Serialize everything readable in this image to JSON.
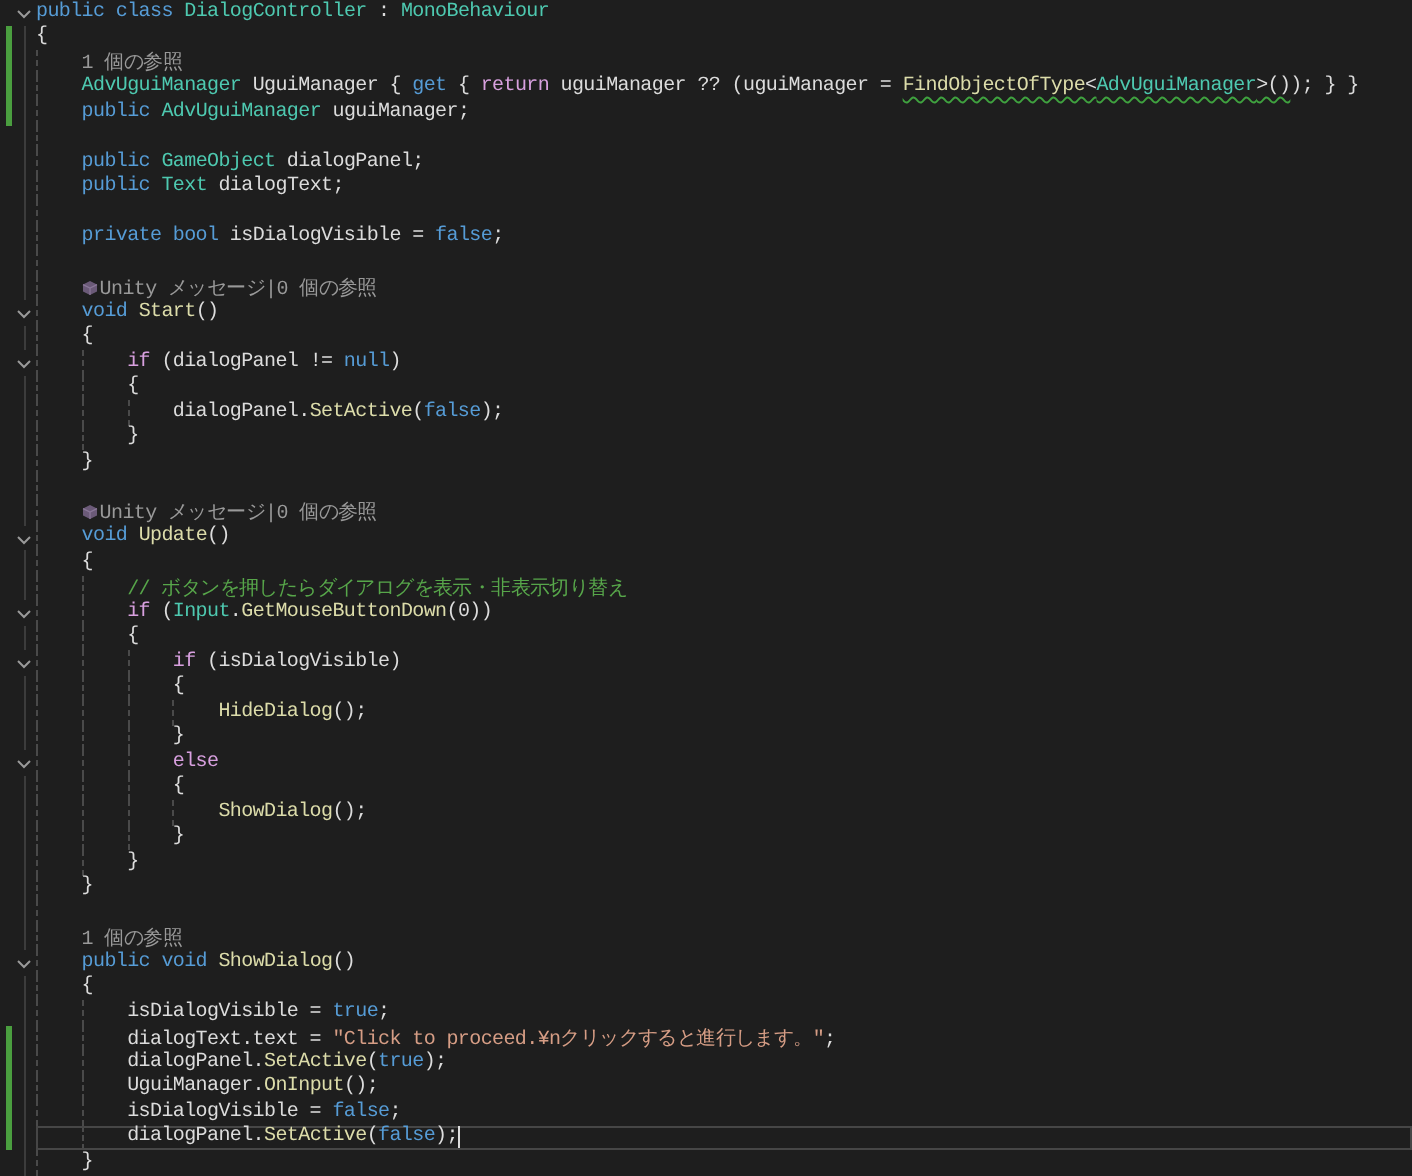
{
  "lines": [
    {
      "kind": "code",
      "fold": true,
      "changed": false,
      "current": false,
      "tokens": [
        {
          "kind": "kw",
          "text": "public class "
        },
        {
          "kind": "type",
          "text": "DialogController"
        },
        {
          "kind": "plain",
          "text": " : "
        },
        {
          "kind": "type",
          "text": "MonoBehaviour"
        }
      ]
    },
    {
      "kind": "code",
      "fold": false,
      "changed": true,
      "current": false,
      "tokens": [
        {
          "kind": "plain",
          "text": "{"
        }
      ],
      "children": [
        {
          "kind": "lens",
          "fold": false,
          "changed": true,
          "current": false,
          "text": "1 個の参照"
        },
        {
          "kind": "code",
          "fold": false,
          "changed": true,
          "current": false,
          "tokens": [
            {
              "kind": "type",
              "text": "AdvUguiManager"
            },
            {
              "kind": "plain",
              "text": " UguiManager { "
            },
            {
              "kind": "kw",
              "text": "get"
            },
            {
              "kind": "plain",
              "text": " { "
            },
            {
              "kind": "ctrl",
              "text": "return"
            },
            {
              "kind": "plain",
              "text": " uguiManager ?? (uguiManager = "
            },
            {
              "kind": "method_warn",
              "text": "FindObjectOfType"
            },
            {
              "kind": "plain_warn",
              "text": "<"
            },
            {
              "kind": "type_warn",
              "text": "AdvUguiManager"
            },
            {
              "kind": "plain_warn",
              "text": ">()"
            },
            {
              "kind": "plain",
              "text": "); } }"
            }
          ]
        },
        {
          "kind": "code",
          "fold": false,
          "changed": true,
          "current": false,
          "tokens": [
            {
              "kind": "kw",
              "text": "public "
            },
            {
              "kind": "type",
              "text": "AdvUguiManager"
            },
            {
              "kind": "plain",
              "text": " uguiManager;"
            }
          ]
        },
        {
          "kind": "blank",
          "fold": false,
          "changed": false,
          "current": false
        },
        {
          "kind": "code",
          "fold": false,
          "changed": false,
          "current": false,
          "tokens": [
            {
              "kind": "kw",
              "text": "public "
            },
            {
              "kind": "type",
              "text": "GameObject"
            },
            {
              "kind": "plain",
              "text": " dialogPanel;"
            }
          ]
        },
        {
          "kind": "code",
          "fold": false,
          "changed": false,
          "current": false,
          "tokens": [
            {
              "kind": "kw",
              "text": "public "
            },
            {
              "kind": "type",
              "text": "Text"
            },
            {
              "kind": "plain",
              "text": " dialogText;"
            }
          ]
        },
        {
          "kind": "blank",
          "fold": false,
          "changed": false,
          "current": false
        },
        {
          "kind": "code",
          "fold": false,
          "changed": false,
          "current": false,
          "tokens": [
            {
              "kind": "kw",
              "text": "private bool "
            },
            {
              "kind": "plain",
              "text": "isDialogVisible = "
            },
            {
              "kind": "kw",
              "text": "false"
            },
            {
              "kind": "plain",
              "text": ";"
            }
          ]
        },
        {
          "kind": "blank",
          "fold": false,
          "changed": false,
          "current": false
        },
        {
          "kind": "unity_lens",
          "fold": false,
          "changed": false,
          "current": false,
          "text": "Unity メッセージ|0 個の参照"
        },
        {
          "kind": "code",
          "fold": true,
          "changed": false,
          "current": false,
          "tokens": [
            {
              "kind": "kw",
              "text": "void "
            },
            {
              "kind": "method",
              "text": "Start"
            },
            {
              "kind": "plain",
              "text": "()"
            }
          ]
        },
        {
          "kind": "code",
          "fold": false,
          "changed": false,
          "current": false,
          "tokens": [
            {
              "kind": "plain",
              "text": "{"
            }
          ],
          "children": [
            {
              "kind": "code",
              "fold": true,
              "changed": false,
              "current": false,
              "tokens": [
                {
                  "kind": "ctrl",
                  "text": "if"
                },
                {
                  "kind": "plain",
                  "text": " (dialogPanel != "
                },
                {
                  "kind": "kw",
                  "text": "null"
                },
                {
                  "kind": "plain",
                  "text": ")"
                }
              ]
            },
            {
              "kind": "code",
              "fold": false,
              "changed": false,
              "current": false,
              "tokens": [
                {
                  "kind": "plain",
                  "text": "{"
                }
              ],
              "children": [
                {
                  "kind": "code",
                  "fold": false,
                  "changed": false,
                  "current": false,
                  "tokens": [
                    {
                      "kind": "plain",
                      "text": "dialogPanel."
                    },
                    {
                      "kind": "method",
                      "text": "SetActive"
                    },
                    {
                      "kind": "plain",
                      "text": "("
                    },
                    {
                      "kind": "kw",
                      "text": "false"
                    },
                    {
                      "kind": "plain",
                      "text": ");"
                    }
                  ]
                }
              ]
            },
            {
              "kind": "code",
              "fold": false,
              "changed": false,
              "current": false,
              "tokens": [
                {
                  "kind": "plain",
                  "text": "}"
                }
              ]
            }
          ]
        },
        {
          "kind": "code",
          "fold": false,
          "changed": false,
          "current": false,
          "tokens": [
            {
              "kind": "plain",
              "text": "}"
            }
          ]
        },
        {
          "kind": "blank",
          "fold": false,
          "changed": false,
          "current": false
        },
        {
          "kind": "unity_lens",
          "fold": false,
          "changed": false,
          "current": false,
          "text": "Unity メッセージ|0 個の参照"
        },
        {
          "kind": "code",
          "fold": true,
          "changed": false,
          "current": false,
          "tokens": [
            {
              "kind": "kw",
              "text": "void "
            },
            {
              "kind": "method",
              "text": "Update"
            },
            {
              "kind": "plain",
              "text": "()"
            }
          ]
        },
        {
          "kind": "code",
          "fold": false,
          "changed": false,
          "current": false,
          "tokens": [
            {
              "kind": "plain",
              "text": "{"
            }
          ],
          "children": [
            {
              "kind": "code",
              "fold": false,
              "changed": false,
              "current": false,
              "tokens": [
                {
                  "kind": "comment",
                  "text": "// ボタンを押したらダイアログを表示・非表示切り替え"
                }
              ]
            },
            {
              "kind": "code",
              "fold": true,
              "changed": false,
              "current": false,
              "tokens": [
                {
                  "kind": "ctrl",
                  "text": "if"
                },
                {
                  "kind": "plain",
                  "text": " ("
                },
                {
                  "kind": "type",
                  "text": "Input"
                },
                {
                  "kind": "plain",
                  "text": "."
                },
                {
                  "kind": "method",
                  "text": "GetMouseButtonDown"
                },
                {
                  "kind": "plain",
                  "text": "(0))"
                }
              ]
            },
            {
              "kind": "code",
              "fold": false,
              "changed": false,
              "current": false,
              "tokens": [
                {
                  "kind": "plain",
                  "text": "{"
                }
              ],
              "children": [
                {
                  "kind": "code",
                  "fold": true,
                  "changed": false,
                  "current": false,
                  "tokens": [
                    {
                      "kind": "ctrl",
                      "text": "if"
                    },
                    {
                      "kind": "plain",
                      "text": " (isDialogVisible)"
                    }
                  ]
                },
                {
                  "kind": "code",
                  "fold": false,
                  "changed": false,
                  "current": false,
                  "tokens": [
                    {
                      "kind": "plain",
                      "text": "{"
                    }
                  ],
                  "children": [
                    {
                      "kind": "code",
                      "fold": false,
                      "changed": false,
                      "current": false,
                      "tokens": [
                        {
                          "kind": "method",
                          "text": "HideDialog"
                        },
                        {
                          "kind": "plain",
                          "text": "();"
                        }
                      ]
                    }
                  ]
                },
                {
                  "kind": "code",
                  "fold": false,
                  "changed": false,
                  "current": false,
                  "tokens": [
                    {
                      "kind": "plain",
                      "text": "}"
                    }
                  ]
                },
                {
                  "kind": "code",
                  "fold": true,
                  "changed": false,
                  "current": false,
                  "tokens": [
                    {
                      "kind": "ctrl",
                      "text": "else"
                    }
                  ]
                },
                {
                  "kind": "code",
                  "fold": false,
                  "changed": false,
                  "current": false,
                  "tokens": [
                    {
                      "kind": "plain",
                      "text": "{"
                    }
                  ],
                  "children": [
                    {
                      "kind": "code",
                      "fold": false,
                      "changed": false,
                      "current": false,
                      "tokens": [
                        {
                          "kind": "method",
                          "text": "ShowDialog"
                        },
                        {
                          "kind": "plain",
                          "text": "();"
                        }
                      ]
                    }
                  ]
                },
                {
                  "kind": "code",
                  "fold": false,
                  "changed": false,
                  "current": false,
                  "tokens": [
                    {
                      "kind": "plain",
                      "text": "}"
                    }
                  ]
                }
              ]
            },
            {
              "kind": "code",
              "fold": false,
              "changed": false,
              "current": false,
              "tokens": [
                {
                  "kind": "plain",
                  "text": "}"
                }
              ]
            }
          ]
        },
        {
          "kind": "code",
          "fold": false,
          "changed": false,
          "current": false,
          "tokens": [
            {
              "kind": "plain",
              "text": "}"
            }
          ]
        },
        {
          "kind": "blank",
          "fold": false,
          "changed": false,
          "current": false
        },
        {
          "kind": "lens",
          "fold": false,
          "changed": false,
          "current": false,
          "text": "1 個の参照"
        },
        {
          "kind": "code",
          "fold": true,
          "changed": false,
          "current": false,
          "tokens": [
            {
              "kind": "kw",
              "text": "public void "
            },
            {
              "kind": "method",
              "text": "ShowDialog"
            },
            {
              "kind": "plain",
              "text": "()"
            }
          ]
        },
        {
          "kind": "code",
          "fold": false,
          "changed": false,
          "current": false,
          "tokens": [
            {
              "kind": "plain",
              "text": "{"
            }
          ],
          "children": [
            {
              "kind": "code",
              "fold": false,
              "changed": false,
              "current": false,
              "tokens": [
                {
                  "kind": "plain",
                  "text": "isDialogVisible = "
                },
                {
                  "kind": "kw",
                  "text": "true"
                },
                {
                  "kind": "plain",
                  "text": ";"
                }
              ]
            },
            {
              "kind": "code",
              "fold": false,
              "changed": true,
              "current": false,
              "tokens": [
                {
                  "kind": "plain",
                  "text": "dialogText.text = "
                },
                {
                  "kind": "string",
                  "text": "\"Click to proceed.¥nクリックすると進行します。\""
                },
                {
                  "kind": "plain",
                  "text": ";"
                }
              ]
            },
            {
              "kind": "code",
              "fold": false,
              "changed": true,
              "current": false,
              "tokens": [
                {
                  "kind": "plain",
                  "text": "dialogPanel."
                },
                {
                  "kind": "method",
                  "text": "SetActive"
                },
                {
                  "kind": "plain",
                  "text": "("
                },
                {
                  "kind": "kw",
                  "text": "true"
                },
                {
                  "kind": "plain",
                  "text": ");"
                }
              ]
            },
            {
              "kind": "code",
              "fold": false,
              "changed": true,
              "current": false,
              "tokens": [
                {
                  "kind": "plain",
                  "text": "UguiManager."
                },
                {
                  "kind": "method",
                  "text": "OnInput"
                },
                {
                  "kind": "plain",
                  "text": "();"
                }
              ]
            },
            {
              "kind": "code",
              "fold": false,
              "changed": true,
              "current": false,
              "tokens": [
                {
                  "kind": "plain",
                  "text": "isDialogVisible = "
                },
                {
                  "kind": "kw",
                  "text": "false"
                },
                {
                  "kind": "plain",
                  "text": ";"
                }
              ]
            },
            {
              "kind": "code",
              "fold": false,
              "changed": true,
              "current": true,
              "tokens": [
                {
                  "kind": "plain",
                  "text": "dialogPanel."
                },
                {
                  "kind": "method",
                  "text": "SetActive"
                },
                {
                  "kind": "plain",
                  "text": "("
                },
                {
                  "kind": "kw",
                  "text": "false"
                },
                {
                  "kind": "plain",
                  "text": ");"
                }
              ]
            }
          ]
        },
        {
          "kind": "code",
          "fold": false,
          "changed": false,
          "current": false,
          "tokens": [
            {
              "kind": "plain",
              "text": "}"
            }
          ]
        }
      ]
    }
  ]
}
